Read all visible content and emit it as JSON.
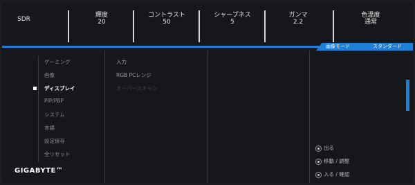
{
  "top": {
    "mode": "SDR",
    "items": [
      {
        "label": "輝度",
        "value": "20"
      },
      {
        "label": "コントラスト",
        "value": "50"
      },
      {
        "label": "シャープネス",
        "value": "5"
      },
      {
        "label": "ガンマ",
        "value": "2.2"
      },
      {
        "label": "色温度",
        "value": "通常"
      }
    ]
  },
  "mode_bar": {
    "label": "画像モード",
    "value": "スタンダード"
  },
  "menu": {
    "items": [
      "ゲーミング",
      "画像",
      "ディスプレイ",
      "PIP/PBP",
      "システム",
      "言語",
      "設定保存",
      "全リセット"
    ],
    "active_index": 2
  },
  "submenu": {
    "items": [
      "入力",
      "RGB PCレンジ",
      "オーバースキャン"
    ]
  },
  "hints": [
    {
      "label": "出る"
    },
    {
      "label": "移動 / 調整"
    },
    {
      "label": "入る / 確認"
    }
  ],
  "brand": "GIGABYTE™",
  "colors": {
    "accent": "#1f7fd6",
    "background": "#16171a"
  }
}
